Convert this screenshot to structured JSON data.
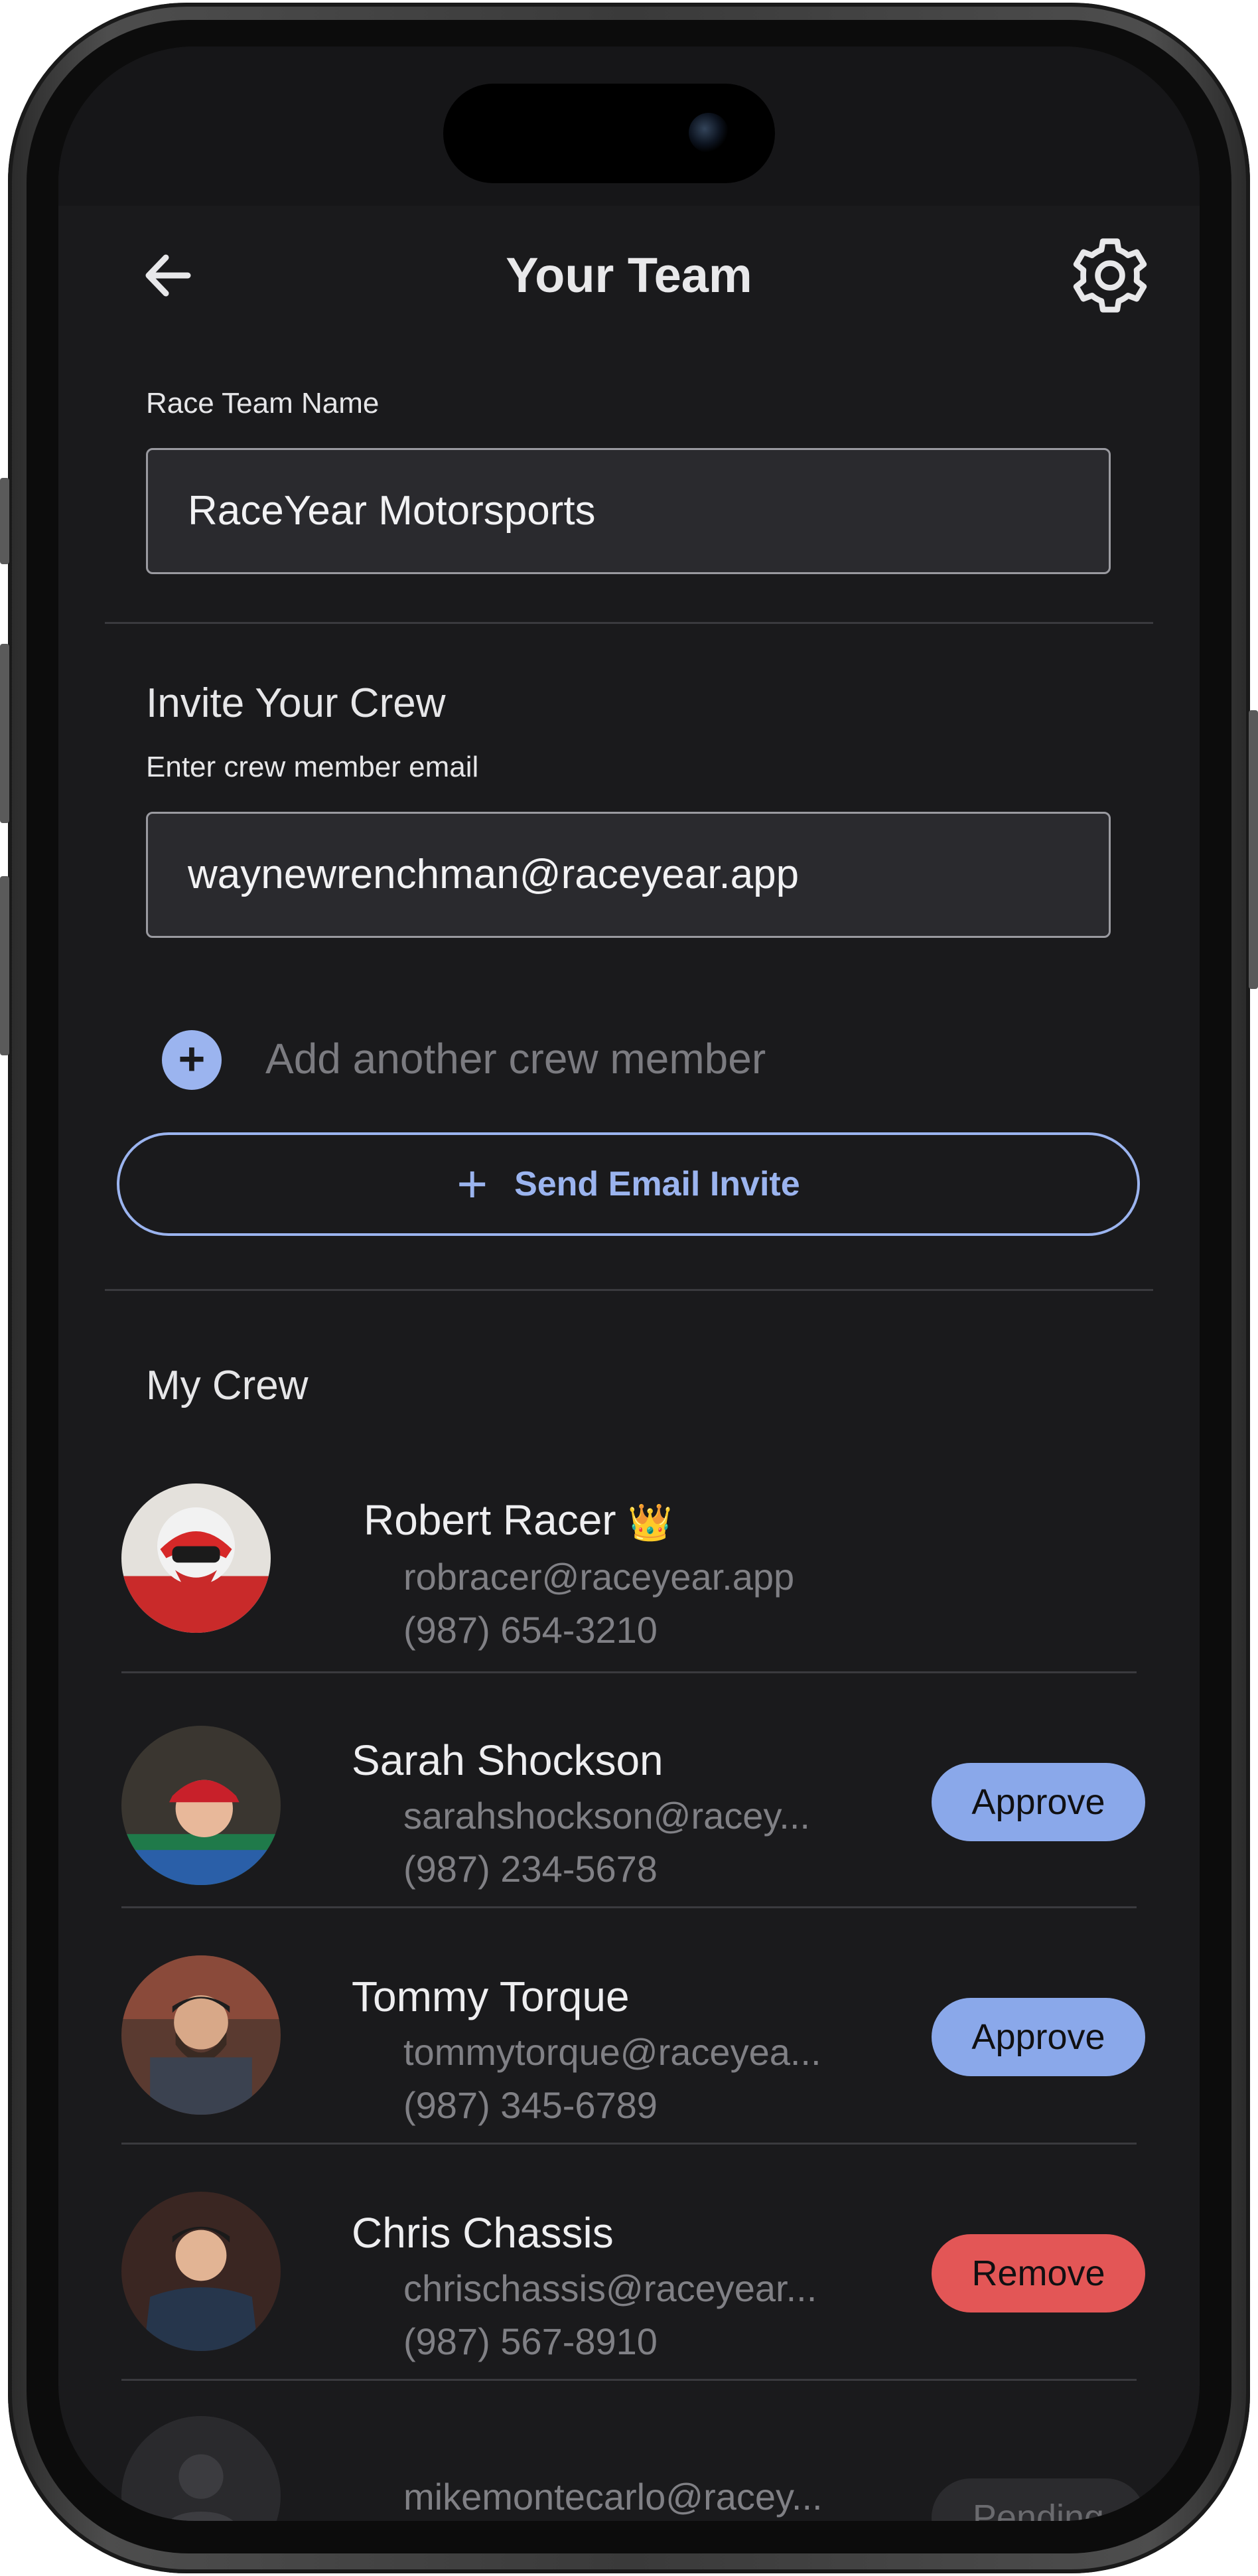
{
  "header": {
    "title": "Your Team"
  },
  "team_name": {
    "label": "Race Team Name",
    "value": "RaceYear Motorsports"
  },
  "invite": {
    "section_title": "Invite Your Crew",
    "email_label": "Enter crew member email",
    "email_value": "waynewrenchman@raceyear.app",
    "add_another_label": "Add another crew member",
    "send_button_label": "Send Email Invite"
  },
  "crew": {
    "section_title": "My Crew",
    "members": [
      {
        "name": "Robert Racer",
        "badge": "👑",
        "email": "robracer@raceyear.app",
        "phone": "(987) 654-3210",
        "action": ""
      },
      {
        "name": "Sarah Shockson",
        "email": "sarahshockson@racey...",
        "phone": "(987) 234-5678",
        "action": "Approve"
      },
      {
        "name": "Tommy Torque",
        "email": "tommytorque@raceyea...",
        "phone": "(987) 345-6789",
        "action": "Approve"
      },
      {
        "name": "Chris Chassis",
        "email": "chrischassis@raceyear...",
        "phone": "(987) 567-8910",
        "action": "Remove"
      },
      {
        "name": "",
        "email": "mikemontecarlo@racey...",
        "phone": "",
        "action": "Pending"
      }
    ]
  },
  "colors": {
    "background": "#1a1a1c",
    "accent": "#9bb4ef",
    "approve": "#8aa8ea",
    "remove": "#e35656"
  }
}
